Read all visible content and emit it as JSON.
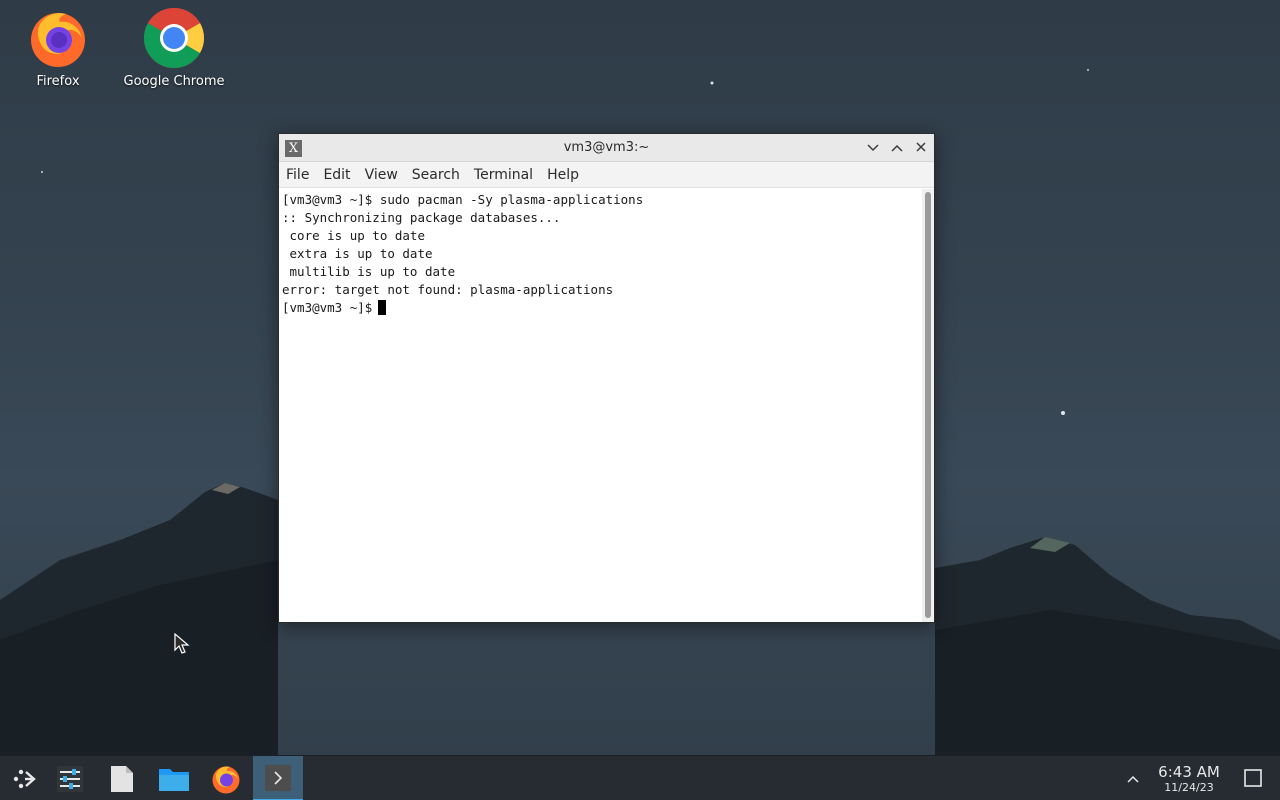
{
  "desktop": {
    "icons": [
      {
        "label": "Firefox",
        "icon": "firefox-icon"
      },
      {
        "label": "Google Chrome",
        "icon": "chrome-icon"
      }
    ]
  },
  "window": {
    "title": "vm3@vm3:~",
    "app_icon": "x-terminal-icon",
    "controls": [
      "minimize-icon",
      "maximize-icon",
      "close-icon"
    ],
    "menu": [
      "File",
      "Edit",
      "View",
      "Search",
      "Terminal",
      "Help"
    ],
    "lines": [
      "[vm3@vm3 ~]$ sudo pacman -Sy plasma-applications",
      ":: Synchronizing package databases...",
      " core is up to date",
      " extra is up to date",
      " multilib is up to date",
      "error: target not found: plasma-applications"
    ],
    "prompt": "[vm3@vm3 ~]$"
  },
  "taskbar": {
    "items": [
      "app-launcher-icon",
      "settings-icon",
      "text-editor-icon",
      "file-manager-icon",
      "firefox-icon",
      "terminal-icon"
    ],
    "active_item": "terminal-icon",
    "clock": {
      "time": "6:43 AM",
      "date": "11/24/23"
    },
    "tray_icon": "chevron-up-icon",
    "show_desktop_icon": "show-desktop-icon",
    "accent": "#3daee9"
  }
}
